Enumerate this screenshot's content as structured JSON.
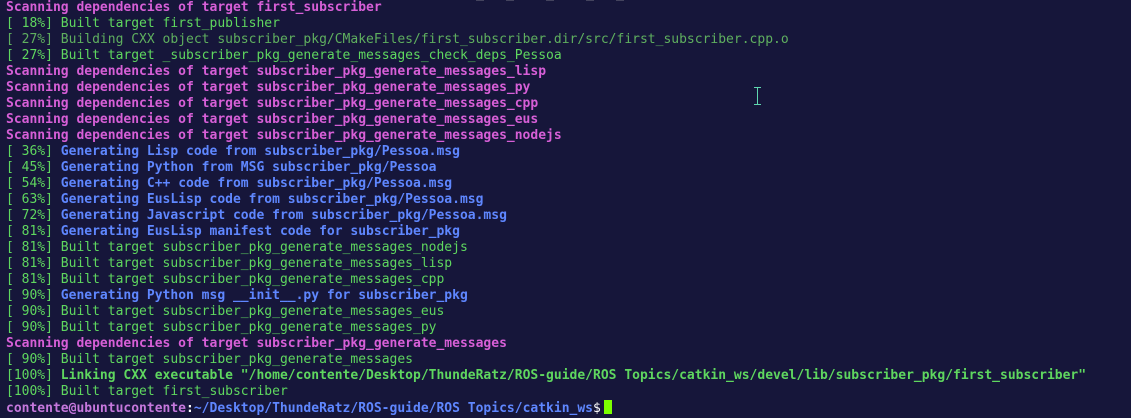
{
  "colors": {
    "background": "#16163a",
    "scan": "#d75fd7",
    "built": "#5fd75f",
    "building": "#5faf5f",
    "generating": "#5f87ff",
    "percent": "#5fd7af",
    "link": "#5fd75f",
    "prompt_user": "#c678dd",
    "prompt_path": "#5f87ff",
    "cursor": "#7cff00"
  },
  "lines": [
    {
      "type": "scan",
      "text": "Scanning dependencies of target first_subscriber"
    },
    {
      "type": "built",
      "percent": "[ 18%]",
      "text": " Built target first_publisher"
    },
    {
      "type": "building",
      "percent": "[ 27%]",
      "text": " Building CXX object subscriber_pkg/CMakeFiles/first_subscriber.dir/src/first_subscriber.cpp.o"
    },
    {
      "type": "built",
      "percent": "[ 27%]",
      "text": " Built target _subscriber_pkg_generate_messages_check_deps_Pessoa"
    },
    {
      "type": "scan",
      "text": "Scanning dependencies of target subscriber_pkg_generate_messages_lisp"
    },
    {
      "type": "scan",
      "text": "Scanning dependencies of target subscriber_pkg_generate_messages_py"
    },
    {
      "type": "scan",
      "text": "Scanning dependencies of target subscriber_pkg_generate_messages_cpp"
    },
    {
      "type": "scan",
      "text": "Scanning dependencies of target subscriber_pkg_generate_messages_eus"
    },
    {
      "type": "scan",
      "text": "Scanning dependencies of target subscriber_pkg_generate_messages_nodejs"
    },
    {
      "type": "generating",
      "percent": "[ 36%]",
      "text": " Generating Lisp code from subscriber_pkg/Pessoa.msg"
    },
    {
      "type": "generating",
      "percent": "[ 45%]",
      "text": " Generating Python from MSG subscriber_pkg/Pessoa"
    },
    {
      "type": "generating",
      "percent": "[ 54%]",
      "text": " Generating C++ code from subscriber_pkg/Pessoa.msg"
    },
    {
      "type": "generating",
      "percent": "[ 63%]",
      "text": " Generating EusLisp code from subscriber_pkg/Pessoa.msg"
    },
    {
      "type": "generating",
      "percent": "[ 72%]",
      "text": " Generating Javascript code from subscriber_pkg/Pessoa.msg"
    },
    {
      "type": "generating",
      "percent": "[ 81%]",
      "text": " Generating EusLisp manifest code for subscriber_pkg"
    },
    {
      "type": "built",
      "percent": "[ 81%]",
      "text": " Built target subscriber_pkg_generate_messages_nodejs"
    },
    {
      "type": "built",
      "percent": "[ 81%]",
      "text": " Built target subscriber_pkg_generate_messages_lisp"
    },
    {
      "type": "built",
      "percent": "[ 81%]",
      "text": " Built target subscriber_pkg_generate_messages_cpp"
    },
    {
      "type": "generating",
      "percent": "[ 90%]",
      "text": " Generating Python msg __init__.py for subscriber_pkg"
    },
    {
      "type": "built",
      "percent": "[ 90%]",
      "text": " Built target subscriber_pkg_generate_messages_eus"
    },
    {
      "type": "built",
      "percent": "[ 90%]",
      "text": " Built target subscriber_pkg_generate_messages_py"
    },
    {
      "type": "scan",
      "text": "Scanning dependencies of target subscriber_pkg_generate_messages"
    },
    {
      "type": "built",
      "percent": "[ 90%]",
      "text": " Built target subscriber_pkg_generate_messages"
    },
    {
      "type": "link",
      "percent": "[100%]",
      "text": " Linking CXX executable \"/home/contente/Desktop/ThundeRatz/ROS-guide/ROS Topics/catkin_ws/devel/lib/subscriber_pkg/first_subscriber\""
    },
    {
      "type": "built",
      "percent": "[100%]",
      "text": " Built target first_subscriber"
    }
  ],
  "prompt": {
    "user_host": "contente@ubuntucontente",
    "separator": ":",
    "path": "~/Desktop/ThundeRatz/ROS-guide/ROS Topics/catkin_ws",
    "symbol": "$ "
  }
}
